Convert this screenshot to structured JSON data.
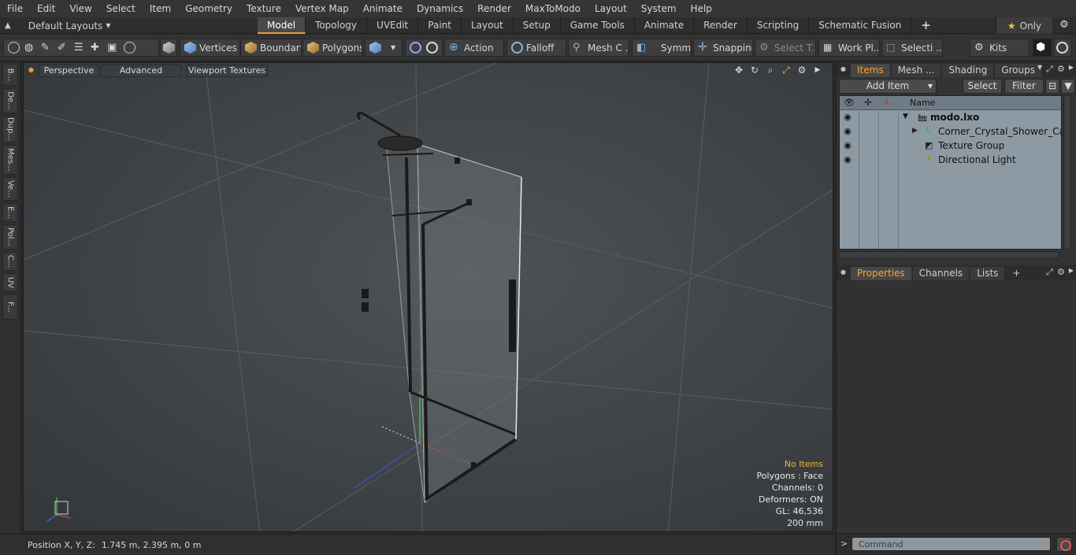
{
  "menu": [
    "File",
    "Edit",
    "View",
    "Select",
    "Item",
    "Geometry",
    "Texture",
    "Vertex Map",
    "Animate",
    "Dynamics",
    "Render",
    "MaxToModo",
    "Layout",
    "System",
    "Help"
  ],
  "layouts": {
    "label": "Default Layouts"
  },
  "tabs": [
    "Model",
    "Topology",
    "UVEdit",
    "Paint",
    "Layout",
    "Setup",
    "Game Tools",
    "Animate",
    "Render",
    "Scripting",
    "Schematic Fusion"
  ],
  "active_tab": "Model",
  "only_label": "Only",
  "toolbar": {
    "vertices": "Vertices",
    "boundary": "Boundary",
    "polygons": "Polygons",
    "action": "Action",
    "falloff": "Falloff",
    "mesh_c": "Mesh C ...",
    "symm": "Symm ...",
    "snapping": "Snapping",
    "select_t": "Select T...",
    "work_pl": "Work Pl...",
    "selecti": "Selecti ...",
    "kits": "Kits"
  },
  "left_tabs": [
    "B...",
    "De...",
    "Dup...",
    "Mes...",
    "Ve...",
    "E...",
    "Pol...",
    "C...",
    "UV",
    "F..."
  ],
  "viewport": {
    "perspective": "Perspective",
    "advanced": "Advanced",
    "viewport_textures": "Viewport Textures",
    "hud": {
      "no_items": "No Items",
      "polygons": "Polygons : Face",
      "channels": "Channels: 0",
      "deformers": "Deformers: ON",
      "gl": "GL: 46,536",
      "scale": "200 mm"
    }
  },
  "status": {
    "label": "Position X, Y, Z:",
    "value": "1.745 m, 2.395 m, 0 m"
  },
  "items_panel": {
    "tabs": [
      "Items",
      "Mesh ...",
      "Shading",
      "Groups"
    ],
    "active": "Items",
    "add_item": "Add Item",
    "select": "Select",
    "filter": "Filter",
    "name_header": "Name",
    "rows": [
      {
        "label": "modo.lxo"
      },
      {
        "label": "Corner_Crystal_Shower_Cabi..."
      },
      {
        "label": "Texture Group"
      },
      {
        "label": "Directional Light"
      }
    ]
  },
  "properties_panel": {
    "tabs": [
      "Properties",
      "Channels",
      "Lists"
    ],
    "active": "Properties"
  },
  "command": {
    "placeholder": "Command"
  },
  "colors": {
    "accent": "#e8a030",
    "hud_warning": "#f2b23a",
    "tree_bg": "#8d9aa4"
  }
}
